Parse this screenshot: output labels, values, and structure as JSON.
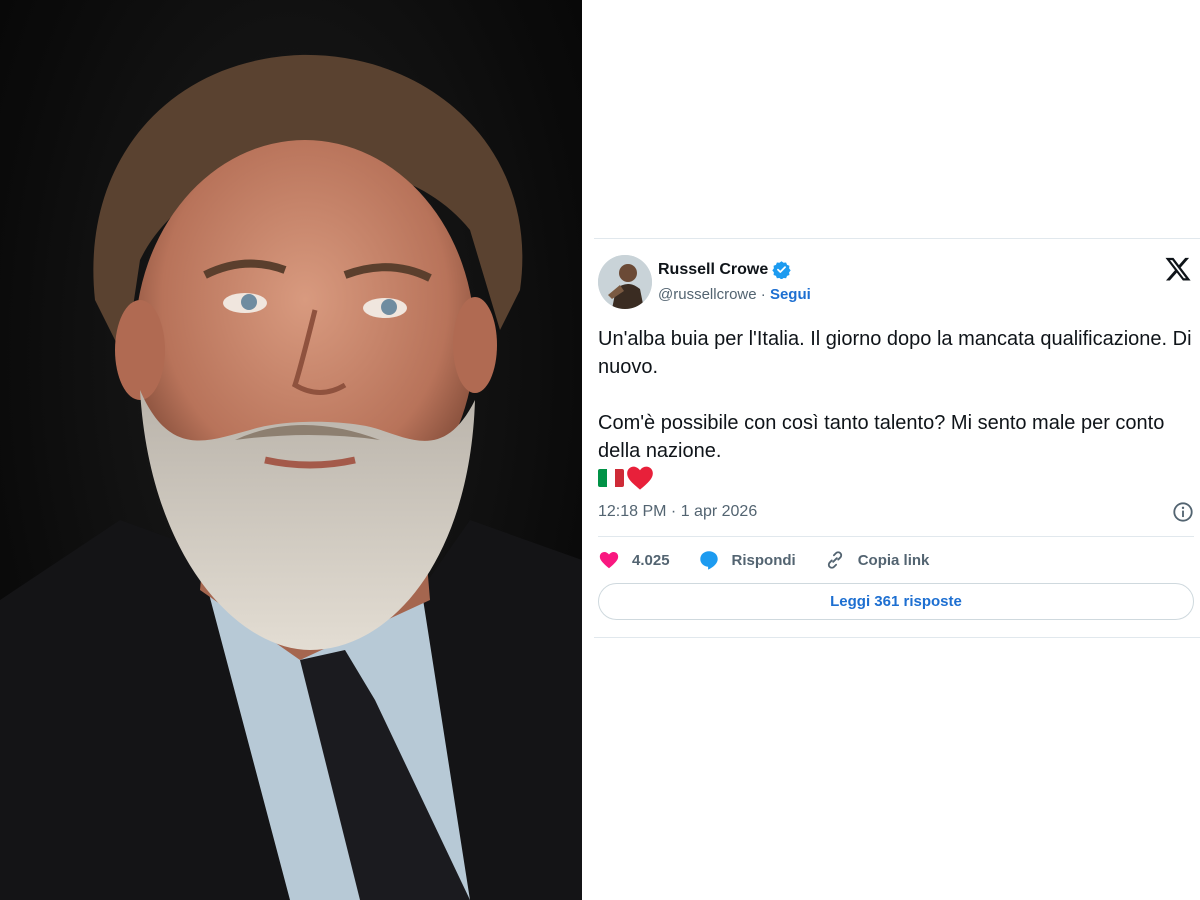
{
  "tweet": {
    "author_name": "Russell Crowe",
    "handle": "@russellcrowe",
    "separator": "·",
    "follow_label": "Segui",
    "text": "Un'alba buia per l'Italia. Il giorno dopo la mancata qualificazione. Di nuovo.\n\nCom'è possibile con così tanto talento? Mi sento male per conto della nazione.",
    "timestamp": "12:18 PM · 1 apr 2026",
    "likes": "4.025",
    "reply_label": "Rispondi",
    "copy_link_label": "Copia link",
    "read_replies_label": "Leggi 361 risposte",
    "icons": [
      "verified-icon",
      "x-logo-icon",
      "italy-flag-icon",
      "heart-emoji-icon",
      "info-icon",
      "like-icon",
      "reply-icon",
      "link-icon"
    ]
  },
  "colors": {
    "accent": "#1d9bf0",
    "link": "#1d6fd1",
    "like": "#f91880",
    "muted": "#536471"
  }
}
